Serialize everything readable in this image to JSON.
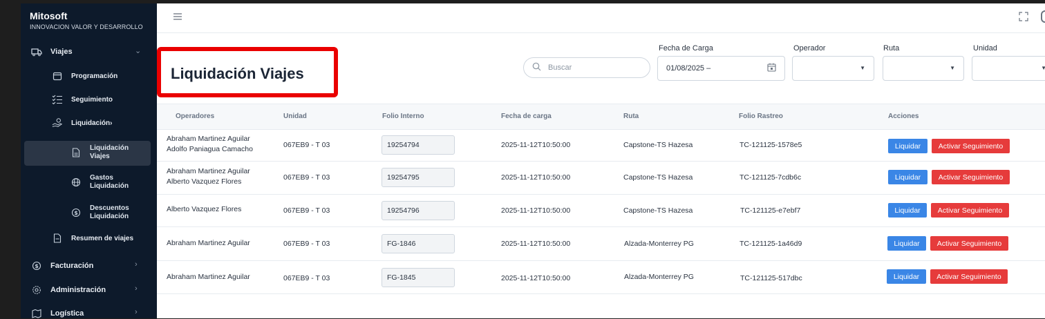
{
  "sidebar": {
    "brand": "Mitosoft",
    "tagline": "INNOVACION VALOR Y DESARROLLO",
    "items": [
      {
        "label": "Viajes",
        "icon": "truck-icon"
      },
      {
        "label": "Programación",
        "icon": "calendar-icon"
      },
      {
        "label": "Seguimiento",
        "icon": "checklist-icon"
      },
      {
        "label": "Liquidación",
        "icon": "hand-coin-icon"
      },
      {
        "label": "Liquidación Viajes",
        "icon": "document-icon"
      },
      {
        "label": "Gastos Liquidación",
        "icon": "globe-icon"
      },
      {
        "label": "Descuentos Liquidación",
        "icon": "dollar-circle-icon"
      },
      {
        "label": "Resumen de viajes",
        "icon": "document-icon"
      },
      {
        "label": "Facturación",
        "icon": "dollar-circle-icon"
      },
      {
        "label": "Administración",
        "icon": "gear-icon"
      },
      {
        "label": "Logística",
        "icon": "map-icon"
      }
    ]
  },
  "page": {
    "title": "Liquidación Viajes"
  },
  "filters": {
    "search_placeholder": "Buscar",
    "fecha_label": "Fecha de Carga",
    "fecha_value": "01/08/2025 –",
    "operador_label": "Operador",
    "ruta_label": "Ruta",
    "unidad_label": "Unidad"
  },
  "table": {
    "headers": [
      "Operadores",
      "Unidad",
      "Folio Interno",
      "Fecha de carga",
      "Ruta",
      "Folio Rastreo",
      "Acciones"
    ],
    "rows": [
      {
        "op1": "Abraham Martinez Aguilar",
        "op2": "Adolfo Paniagua Camacho",
        "unidad": "067EB9 - T 03",
        "folio": "19254794",
        "fecha": "2025-11-12T10:50:00",
        "ruta": "Capstone-TS Hazesa",
        "rastreo": "TC-121125-1578e5"
      },
      {
        "op1": "Abraham Martinez Aguilar",
        "op2": "Alberto Vazquez Flores",
        "unidad": "067EB9 - T 03",
        "folio": "19254795",
        "fecha": "2025-11-12T10:50:00",
        "ruta": "Capstone-TS Hazesa",
        "rastreo": "TC-121125-7cdb6c"
      },
      {
        "op1": "Alberto Vazquez Flores",
        "op2": "",
        "unidad": "067EB9 - T 03",
        "folio": "19254796",
        "fecha": "2025-11-12T10:50:00",
        "ruta": "Capstone-TS Hazesa",
        "rastreo": "TC-121125-e7ebf7"
      },
      {
        "op1": "Abraham Martinez Aguilar",
        "op2": "",
        "unidad": "067EB9 - T 03",
        "folio": "FG-1846",
        "fecha": "2025-11-12T10:50:00",
        "ruta": "Alzada-Monterrey PG",
        "rastreo": "TC-121125-1a46d9"
      },
      {
        "op1": "Abraham Martinez Aguilar",
        "op2": "",
        "unidad": "067EB9 - T 03",
        "folio": "FG-1845",
        "fecha": "2025-11-12T10:50:00",
        "ruta": "Alzada-Monterrey PG",
        "rastreo": "TC-121125-517dbc"
      }
    ],
    "btn_liquidar": "Liquidar",
    "btn_activar": "Activar Seguimiento"
  },
  "colors": {
    "sidebar_bg": "#0d1a2b",
    "highlight_red": "#ea0000",
    "btn_blue": "#3a86e6",
    "btn_red": "#e63b3b"
  }
}
